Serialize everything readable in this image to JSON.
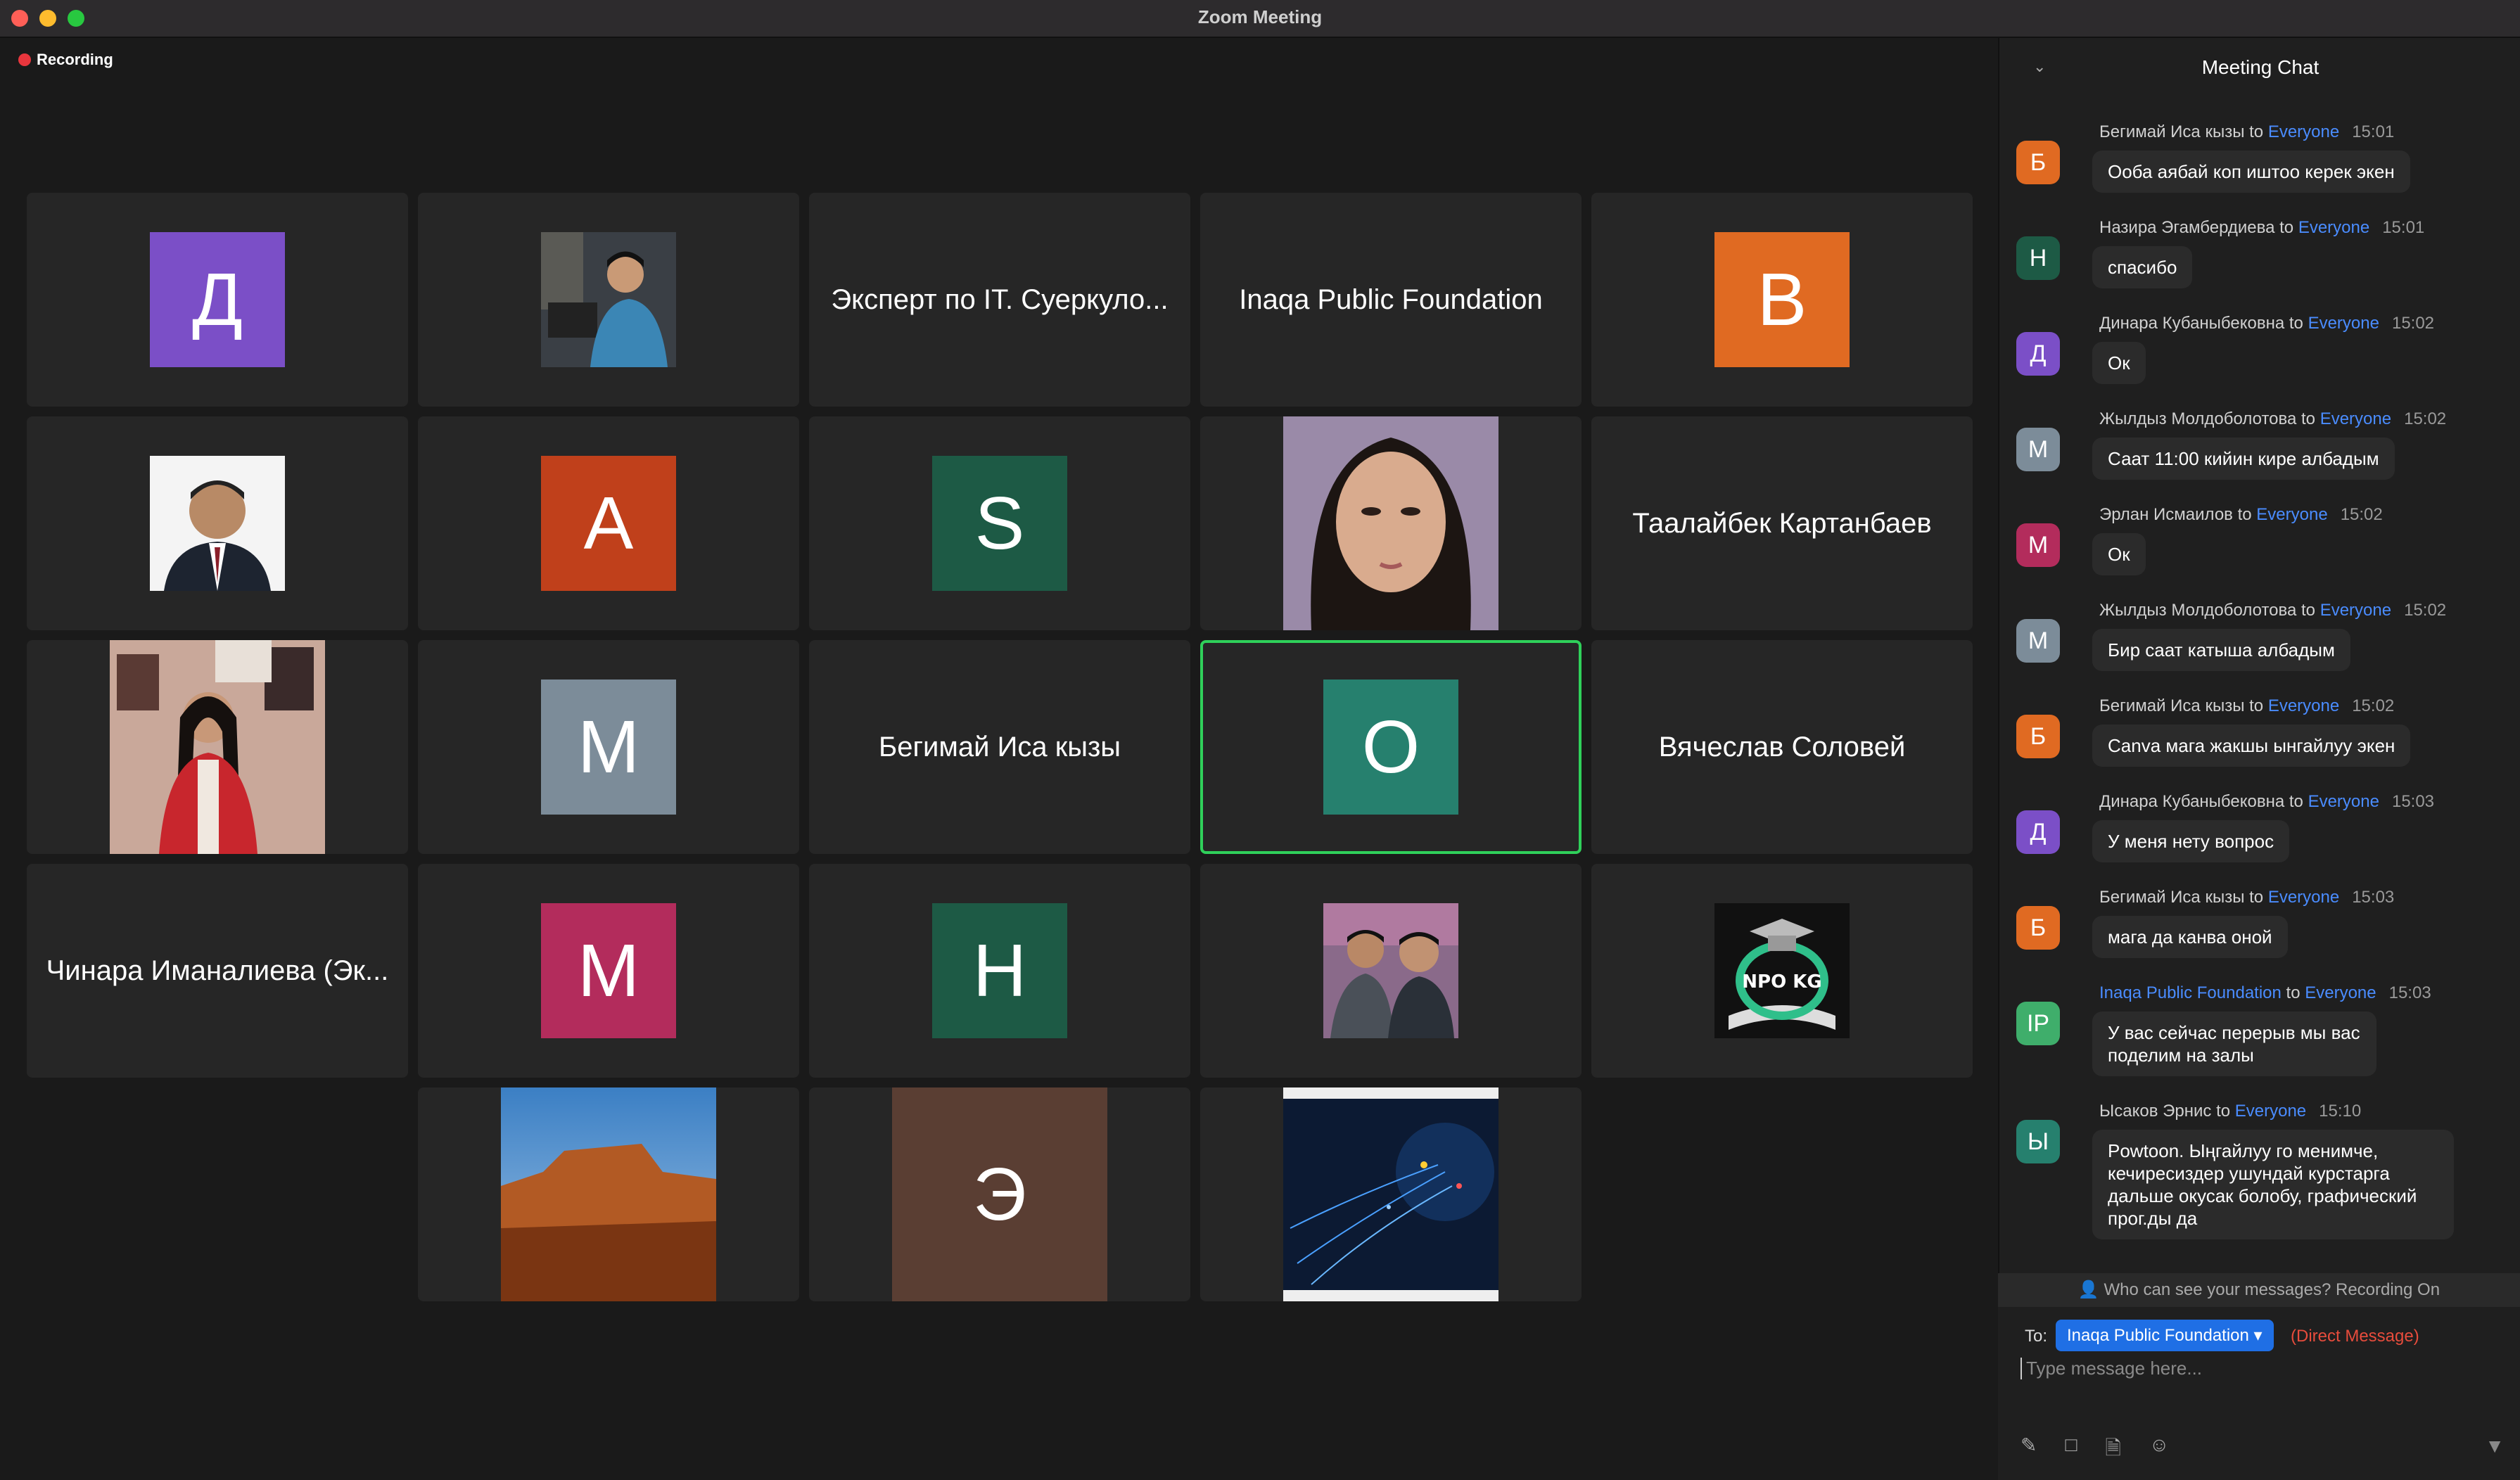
{
  "window": {
    "title": "Zoom Meeting"
  },
  "recording": {
    "label": "Recording"
  },
  "tiles": {
    "t1": {
      "letter": "Д",
      "color": "#7b4fc7"
    },
    "t3": {
      "name": "Эксперт по IT. Суеркуло..."
    },
    "t4": {
      "name": "Inaqa Public Foundation"
    },
    "t5": {
      "letter": "В",
      "color": "#e06a22"
    },
    "t7": {
      "letter": "А",
      "color": "#c0401b"
    },
    "t8": {
      "letter": "S",
      "color": "#1d5a45"
    },
    "t10": {
      "name": "Таалайбек Картанбаев"
    },
    "t12": {
      "letter": "М",
      "color": "#7c8c99"
    },
    "t13": {
      "name": "Бегимай Иса кызы"
    },
    "t14": {
      "letter": "О",
      "color": "#26806e"
    },
    "t15": {
      "name": "Вячеслав Соловей"
    },
    "t16": {
      "name": "Чинара Иманалиева (Эк..."
    },
    "t17": {
      "letter": "М",
      "color": "#b32c5c"
    },
    "t18": {
      "letter": "Н",
      "color": "#1d5a45"
    },
    "t22": {
      "letter": "Э",
      "color": "#5a3e33"
    }
  },
  "chat": {
    "title": "Meeting Chat",
    "messages": [
      {
        "sender": "Бегимай Иса кызы",
        "to": "to",
        "recipient": "Everyone",
        "time": "15:01",
        "avatar": "Б",
        "avatar_color": "#e06a22",
        "text": "Ооба аябай коп иштоо керек экен"
      },
      {
        "sender": "Назира Эгамбердиева",
        "to": "to",
        "recipient": "Everyone",
        "time": "15:01",
        "avatar": "Н",
        "avatar_color": "#1d5a45",
        "text": "спасибо"
      },
      {
        "sender": "Динара Кубаныбековна",
        "to": "to",
        "recipient": "Everyone",
        "time": "15:02",
        "avatar": "Д",
        "avatar_color": "#7b4fc7",
        "text": "Ок"
      },
      {
        "sender": "Жылдыз Молдоболотова",
        "to": "to",
        "recipient": "Everyone",
        "time": "15:02",
        "avatar": "М",
        "avatar_color": "#7c8c99",
        "text": "Саат 11:00 кийин кире албадым"
      },
      {
        "sender": "Эрлан Исмаилов",
        "to": "to",
        "recipient": "Everyone",
        "time": "15:02",
        "avatar": "М",
        "avatar_color": "#b32c5c",
        "text": "Ок"
      },
      {
        "sender": "Жылдыз Молдоболотова",
        "to": "to",
        "recipient": "Everyone",
        "time": "15:02",
        "avatar": "М",
        "avatar_color": "#7c8c99",
        "text": "Бир саат катыша албадым"
      },
      {
        "sender": "Бегимай Иса кызы",
        "to": "to",
        "recipient": "Everyone",
        "time": "15:02",
        "avatar": "Б",
        "avatar_color": "#e06a22",
        "text": "Canva мага жакшы ынгайлуу экен"
      },
      {
        "sender": "Динара Кубаныбековна",
        "to": "to",
        "recipient": "Everyone",
        "time": "15:03",
        "avatar": "Д",
        "avatar_color": "#7b4fc7",
        "text": "У меня нету вопрос"
      },
      {
        "sender": "Бегимай Иса кызы",
        "to": "to",
        "recipient": "Everyone",
        "time": "15:03",
        "avatar": "Б",
        "avatar_color": "#e06a22",
        "text": "мага да канва оной"
      },
      {
        "sender": "Inaqa Public Foundation",
        "to": "to",
        "recipient": "Everyone",
        "time": "15:03",
        "avatar": "IP",
        "avatar_color": "#3fae6b",
        "text": "У вас сейчас перерыв мы вас поделим на залы"
      },
      {
        "sender": "Ысаков Эрнис",
        "to": "to",
        "recipient": "Everyone",
        "time": "15:10",
        "avatar": "Ы",
        "avatar_color": "#26806e",
        "text": "Powtoon. Ыңгайлуу го менимче, кечиресиздер ушундай курстарга дальше окусак болобу, графический прог.ды да"
      }
    ],
    "privacy": "Who can see your messages? Recording On",
    "to_label": "To:",
    "recipient": "Inaqa Public Foundation",
    "direct": "(Direct Message)",
    "placeholder": "Type message here..."
  }
}
